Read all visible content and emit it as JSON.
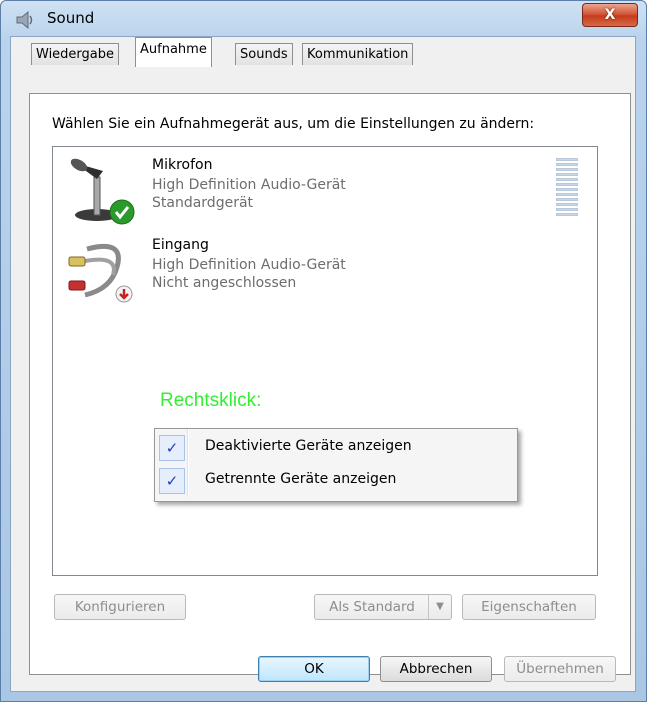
{
  "window": {
    "title": "Sound",
    "close_label": "X"
  },
  "tabs": [
    {
      "label": "Wiedergabe",
      "active": false
    },
    {
      "label": "Aufnahme",
      "active": true
    },
    {
      "label": "Sounds",
      "active": false
    },
    {
      "label": "Kommunikation",
      "active": false
    }
  ],
  "instruction": "Wählen Sie ein Aufnahmegerät aus, um die Einstellungen zu ändern:",
  "devices": [
    {
      "name": "Mikrofon",
      "driver": "High Definition Audio-Gerät",
      "status": "Standardgerät",
      "icon": "microphone-icon",
      "badge": "green-check-icon"
    },
    {
      "name": "Eingang",
      "driver": "High Definition Audio-Gerät",
      "status": "Nicht angeschlossen",
      "icon": "audio-cable-icon",
      "badge": "red-arrow-down-icon"
    }
  ],
  "hint": "Rechtsklick:",
  "context_menu": [
    {
      "label": "Deaktivierte Geräte anzeigen",
      "checked": true
    },
    {
      "label": "Getrennte Geräte anzeigen",
      "checked": true
    }
  ],
  "buttons": {
    "configure": "Konfigurieren",
    "set_default": "Als Standard",
    "properties": "Eigenschaften",
    "ok": "OK",
    "cancel": "Abbrechen",
    "apply": "Übernehmen"
  },
  "colors": {
    "hint": "#33ee33",
    "close": "#c43c1c",
    "check": "#2a9a2a"
  }
}
